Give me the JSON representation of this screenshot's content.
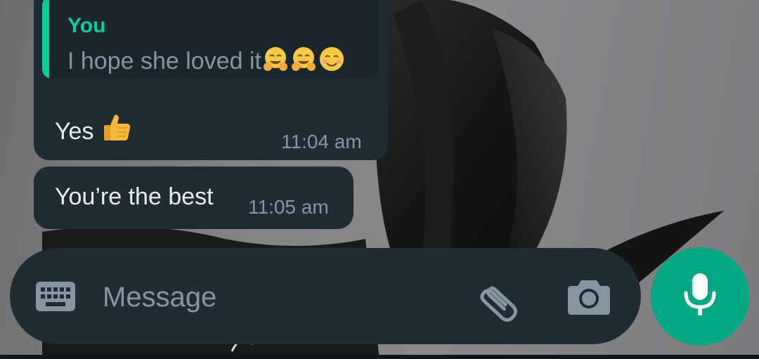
{
  "messages": [
    {
      "reply": {
        "author": "You",
        "text": "I hope she loved it"
      },
      "text": "Yes",
      "time": "11:04 am"
    },
    {
      "text": "You’re the best",
      "time": "11:05 am"
    }
  ],
  "composer": {
    "placeholder": "Message"
  },
  "icons": {
    "keyboard": "keyboard-icon",
    "attach": "paperclip-icon",
    "camera": "camera-icon",
    "mic": "microphone-icon",
    "reply_emojis": [
      "hugging-face-emoji",
      "hugging-face-emoji",
      "smiling-face-emoji"
    ],
    "reaction_emoji": "thumbs-up-emoji"
  },
  "colors": {
    "bubble": "#1f2c34",
    "accent": "#06cf9c",
    "mic_button": "#00a884",
    "muted_text": "#8696a0",
    "text": "#e9edef"
  }
}
